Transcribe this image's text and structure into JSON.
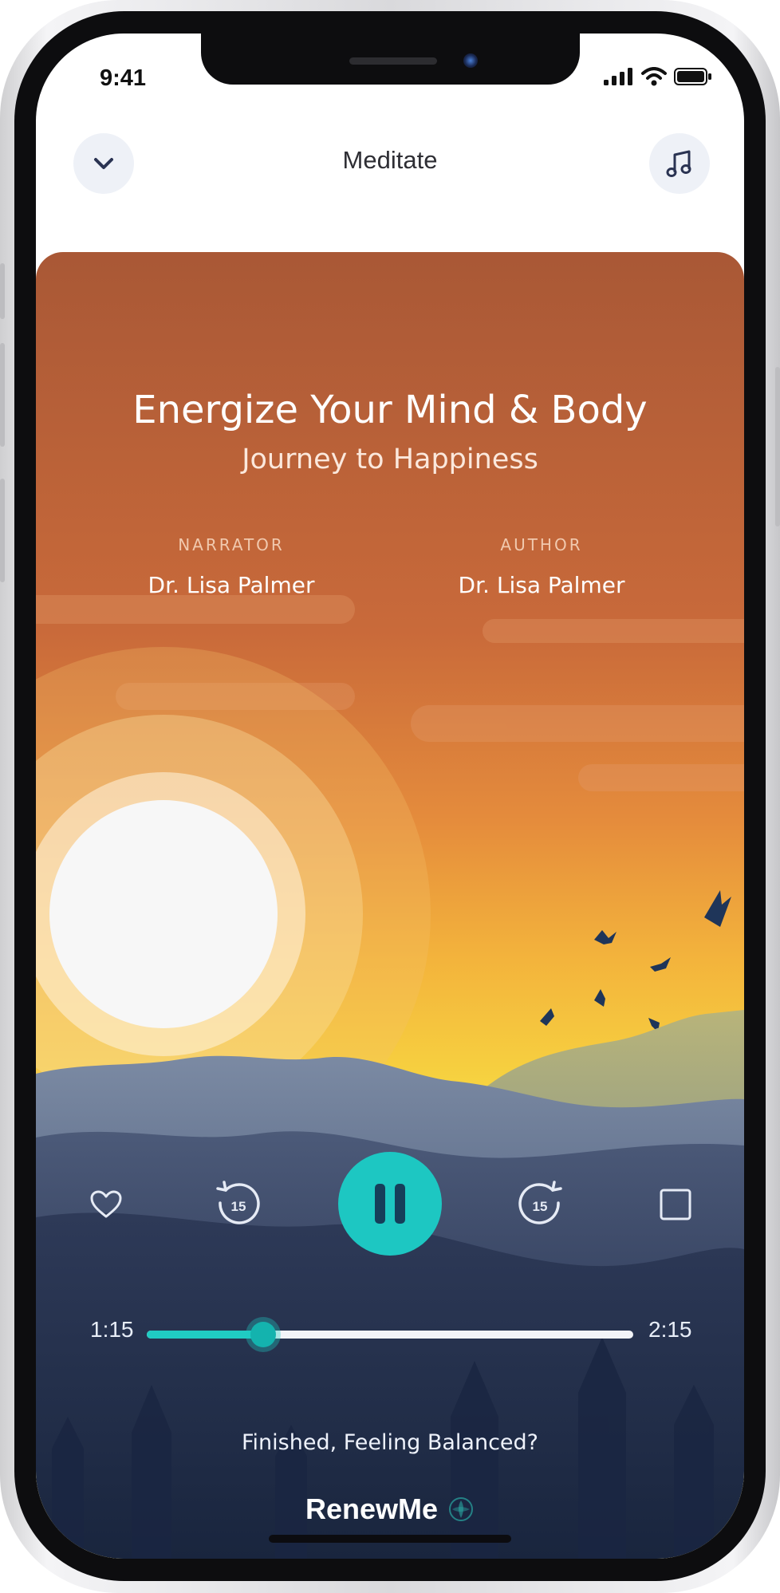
{
  "status_bar": {
    "time": "9:41"
  },
  "nav": {
    "title": "Meditate",
    "collapse_icon": "chevron-down-icon",
    "music_icon": "music-note-icon"
  },
  "session": {
    "title": "Energize Your Mind & Body",
    "subtitle": "Journey to Happiness",
    "narrator_label": "NARRATOR",
    "narrator_name": "Dr. Lisa Palmer",
    "author_label": "AUTHOR",
    "author_name": "Dr. Lisa Palmer"
  },
  "controls": {
    "favorite_icon": "heart-icon",
    "rewind_label": "15",
    "play_state": "playing",
    "forward_label": "15",
    "stop_icon": "square-icon"
  },
  "progress": {
    "elapsed": "1:15",
    "total": "2:15",
    "value": 0.24
  },
  "prompt": "Finished, Feeling Balanced?",
  "brand": "RenewMe",
  "colors": {
    "accent": "#1dc7c2",
    "sky_top": "#a95836",
    "sky_bottom": "#f7d540"
  }
}
